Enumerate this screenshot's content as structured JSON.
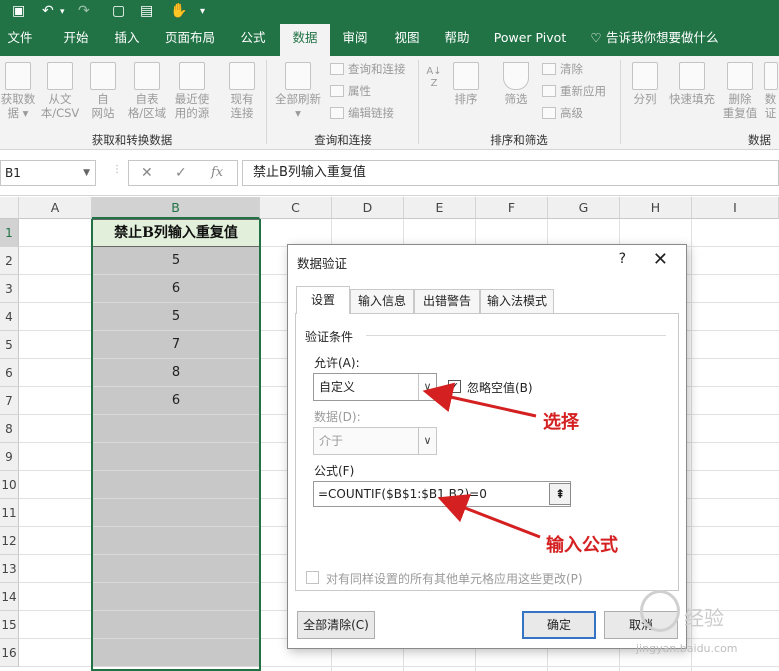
{
  "quick_access": {
    "save_icon": "save-icon",
    "undo_icon": "undo-icon",
    "redo_icon": "redo-icon"
  },
  "tabs": [
    {
      "label": "文件"
    },
    {
      "label": "开始"
    },
    {
      "label": "插入"
    },
    {
      "label": "页面布局"
    },
    {
      "label": "公式"
    },
    {
      "label": "数据"
    },
    {
      "label": "审阅"
    },
    {
      "label": "视图"
    },
    {
      "label": "帮助"
    },
    {
      "label": "Power Pivot"
    },
    {
      "label": "告诉我你想要做什么"
    }
  ],
  "ribbon": {
    "get_data_l1": "获取数",
    "get_data_l2": "据",
    "from_csv_l1": "从文",
    "from_csv_l2": "本/CSV",
    "from_web_l1": "自",
    "from_web_l2": "网站",
    "from_table_l1": "自表",
    "from_table_l2": "格/区域",
    "recent_l1": "最近使",
    "recent_l2": "用的源",
    "existing_l1": "现有",
    "existing_l2": "连接",
    "group1": "获取和转换数据",
    "refresh_l1": "全部刷新",
    "queries": "查询和连接",
    "properties": "属性",
    "edit_links": "编辑链接",
    "group2": "查询和连接",
    "sort": "排序",
    "filter": "筛选",
    "clear": "清除",
    "reapply": "重新应用",
    "advanced": "高级",
    "group3": "排序和筛选",
    "split": "分列",
    "flash_fill": "快速填充",
    "remove_dup_l1": "删除",
    "remove_dup_l2": "重复值",
    "validation_l1": "数",
    "validation_l2": "证",
    "group4": "数据"
  },
  "formula_bar": {
    "name_box": "B1",
    "content": "禁止B列输入重复值",
    "cancel": "✕",
    "enter": "✓",
    "fx": "fx"
  },
  "grid": {
    "columns": [
      "A",
      "B",
      "C",
      "D",
      "E",
      "F",
      "G",
      "H",
      "I"
    ],
    "rows": [
      "1",
      "2",
      "3",
      "4",
      "5",
      "6",
      "7",
      "8",
      "9",
      "10",
      "11",
      "12",
      "13",
      "14",
      "15",
      "16"
    ],
    "b_header": "禁止B列输入重复值",
    "b_values": [
      "5",
      "6",
      "5",
      "7",
      "8",
      "6"
    ]
  },
  "dialog": {
    "title": "数据验证",
    "help": "?",
    "close": "✕",
    "tabs": [
      "设置",
      "输入信息",
      "出错警告",
      "输入法模式"
    ],
    "section": "验证条件",
    "allow_label": "允许(A):",
    "allow_value": "自定义",
    "ignore_blank": "忽略空值(B)",
    "data_label": "数据(D):",
    "data_value": "介于",
    "formula_label": "公式(F)",
    "formula_value": "=COUNTIF($B$1:$B1,B2)=0",
    "apply_all": "对有同样设置的所有其他单元格应用这些更改(P)",
    "clear_all": "全部清除(C)",
    "ok": "确定",
    "cancel": "取消"
  },
  "annotations": {
    "select": "选择",
    "enter_formula": "输入公式",
    "color": "#d42020"
  },
  "watermark": {
    "brand": "经验",
    "url": "jingyan.baidu.com"
  }
}
